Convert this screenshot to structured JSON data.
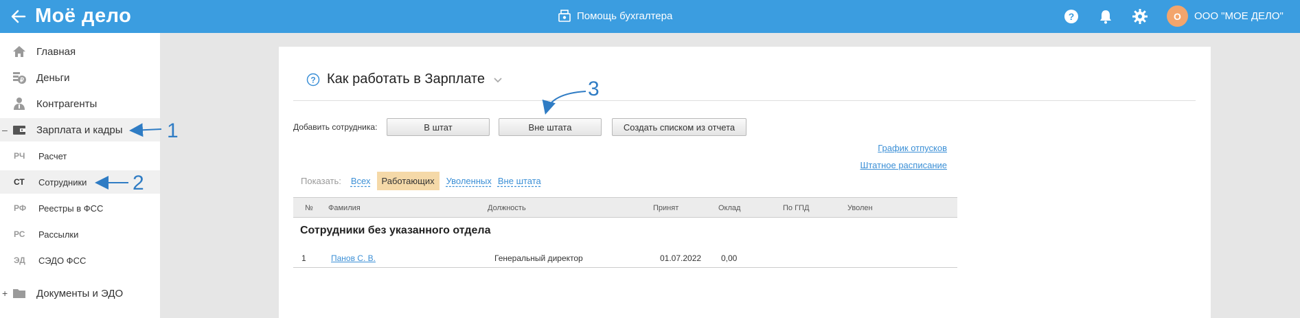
{
  "header": {
    "logo": "Moё дело",
    "help_center": "Помощь бухгалтера",
    "avatar_initial": "О",
    "org_name": "ООО \"МОЕ ДЕЛО\""
  },
  "sidebar": {
    "items": [
      {
        "label": "Главная",
        "icon": "home-icon"
      },
      {
        "label": "Деньги",
        "icon": "money-icon"
      },
      {
        "label": "Контрагенты",
        "icon": "contractors-icon"
      },
      {
        "label": "Зарплата и кадры",
        "icon": "wallet-icon",
        "toggle": "–"
      },
      {
        "label": "Документы и ЭДО",
        "icon": "folder-icon",
        "toggle": "+"
      }
    ],
    "subitems": [
      {
        "abbr": "РЧ",
        "label": "Расчет"
      },
      {
        "abbr": "СТ",
        "label": "Сотрудники"
      },
      {
        "abbr": "РФ",
        "label": "Реестры в ФСС"
      },
      {
        "abbr": "РС",
        "label": "Рассылки"
      },
      {
        "abbr": "ЭД",
        "label": "СЭДО ФСС"
      }
    ]
  },
  "main": {
    "title": "Как работать в Зарплате",
    "add_label": "Добавить сотрудника:",
    "buttons": [
      "В штат",
      "Вне штата",
      "Создать списком из отчета"
    ],
    "links": [
      "График отпусков",
      "Штатное расписание"
    ],
    "filter": {
      "label": "Показать:",
      "options": [
        "Всех",
        "Работающих",
        "Уволенных",
        "Вне штата"
      ],
      "active": "Работающих"
    },
    "table": {
      "columns": [
        "№",
        "Фамилия",
        "Должность",
        "Принят",
        "Оклад",
        "По ГПД",
        "Уволен"
      ],
      "section": "Сотрудники без указанного отдела",
      "rows": [
        {
          "num": "1",
          "name": "Панов С. В.",
          "position": "Генеральный директор",
          "hired": "01.07.2022",
          "salary": "0,00",
          "gpd": "",
          "fired": ""
        }
      ]
    }
  },
  "annotations": [
    "1",
    "2",
    "3"
  ],
  "colors": {
    "header": "#3b9de0",
    "accent_link": "#3b8fd6",
    "annotation": "#2f7cc4",
    "filter_active": "#f5d9a8"
  }
}
